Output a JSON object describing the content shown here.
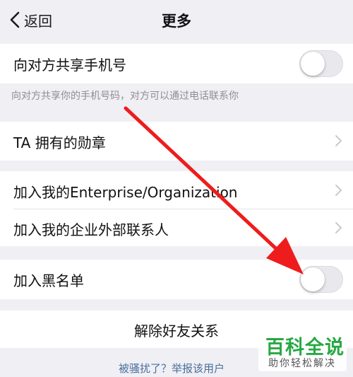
{
  "nav": {
    "back_label": "返回",
    "title": "更多"
  },
  "rows": {
    "share_phone": {
      "label": "向对方共享手机号",
      "toggle_on": false
    },
    "share_phone_hint": "向对方共享你的手机号码，对方可以通过电话联系你",
    "badges": {
      "label": "TA 拥有的勋章"
    },
    "join_enterprise": {
      "label": "加入我的Enterprise/Organization"
    },
    "join_external_contacts": {
      "label": "加入我的企业外部联系人"
    },
    "blacklist": {
      "label": "加入黑名单",
      "toggle_on": false
    },
    "remove_friend": {
      "label": "解除好友关系"
    }
  },
  "report_link": "被骚扰了？举报该用户",
  "annotation": {
    "arrow_color": "#ee1c1c"
  },
  "watermark": {
    "title": "百科全说",
    "subtitle": "助你轻松解决",
    "color": "#27a844"
  },
  "colors": {
    "background": "#efeff4",
    "cell": "#ffffff",
    "hint_text": "#8e8e93",
    "link": "#4a6f9b"
  }
}
